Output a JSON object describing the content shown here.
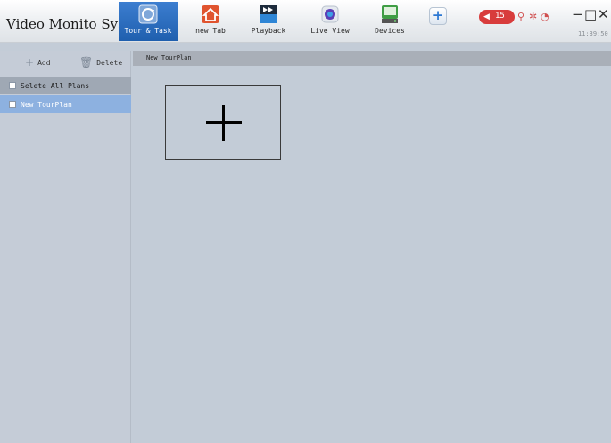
{
  "app": {
    "title": "Video Monito System"
  },
  "tabs": [
    {
      "label": "Tour & Task",
      "icon": "tour-task-icon",
      "active": true
    },
    {
      "label": "new Tab",
      "icon": "home-icon"
    },
    {
      "label": "Playback",
      "icon": "playback-icon"
    },
    {
      "label": "Live View",
      "icon": "live-view-icon"
    },
    {
      "label": "Devices",
      "icon": "devices-icon"
    }
  ],
  "status": {
    "alarm_count": "15",
    "clock": "11:39:50"
  },
  "sidebar": {
    "add_label": "Add",
    "delete_label": "Delete",
    "select_all_label": "Selete All Plans",
    "plans": [
      {
        "label": "New TourPlan",
        "selected": true
      }
    ]
  },
  "main": {
    "header_title": "New TourPlan"
  },
  "colors": {
    "active_tab": "#2a6cc0",
    "selected_row": "#8db1e0",
    "alarm": "#d83c3c",
    "background": "#c3ccd7"
  }
}
